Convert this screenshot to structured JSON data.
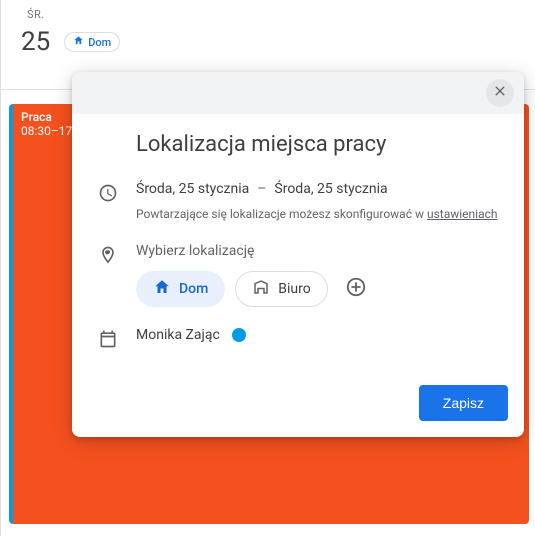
{
  "day": {
    "weekday": "ŚR.",
    "number": "25",
    "chip_label": "Dom"
  },
  "event": {
    "title": "Praca",
    "time": "08:30–17:"
  },
  "dialog": {
    "title": "Lokalizacja miejsca pracy",
    "date_start": "Środa, 25 stycznia",
    "date_end": "Środa, 25 stycznia",
    "dash": "–",
    "hint_prefix": "Powtarzające się lokalizacje możesz skonfigurować w ",
    "hint_link": "ustawieniach",
    "choose_label": "Wybierz lokalizację",
    "option_home": "Dom",
    "option_office": "Biuro",
    "owner": "Monika Zając",
    "save": "Zapisz"
  }
}
